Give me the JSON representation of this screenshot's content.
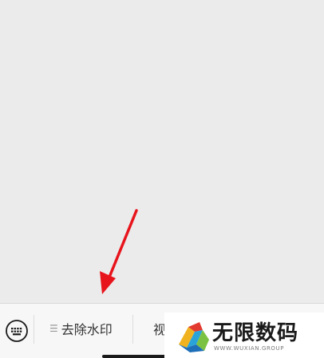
{
  "menu": {
    "items": [
      {
        "label": "去除水印",
        "icon": "menu-lines-icon"
      },
      {
        "label": "视"
      }
    ]
  },
  "keyboard_icon": "keyboard-icon",
  "annotation": {
    "color": "#e8141c"
  },
  "watermark": {
    "brand": "无限数码",
    "url": "WWW.WUXIAN.GROUP"
  }
}
